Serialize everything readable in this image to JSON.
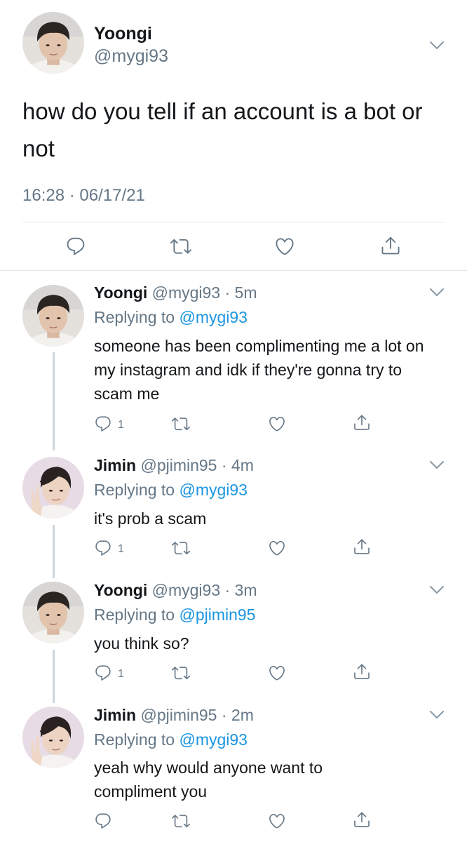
{
  "main_tweet": {
    "name": "Yoongi",
    "handle": "@mygi93",
    "text": "how do you tell if an account is a bot or not",
    "timestamp": "16:28 · 06/17/21"
  },
  "replies": [
    {
      "name": "Yoongi",
      "handle_time": "@mygi93 · 5m",
      "replying_prefix": "Replying to",
      "replying_to": "@mygi93",
      "text": "someone has been complimenting me a lot on my instagram and idk if they're gonna try to scam me",
      "reply_count": "1"
    },
    {
      "name": "Jimin",
      "handle_time": "@pjimin95 · 4m",
      "replying_prefix": "Replying to",
      "replying_to": "@mygi93",
      "text": "it's prob a scam",
      "reply_count": "1"
    },
    {
      "name": "Yoongi",
      "handle_time": "@mygi93 · 3m",
      "replying_prefix": "Replying to",
      "replying_to": "@pjimin95",
      "text": "you think so?",
      "reply_count": "1"
    },
    {
      "name": "Jimin",
      "handle_time": "@pjimin95 · 2m",
      "replying_prefix": "Replying to",
      "replying_to": "@mygi93",
      "text": "yeah why would anyone want to compliment you",
      "reply_count": ""
    }
  ],
  "colors": {
    "text": "#14171a",
    "secondary": "#657786",
    "accent": "#1b95e0",
    "divider": "#e1e8ed"
  },
  "icons": [
    "reply-icon",
    "retweet-icon",
    "like-icon",
    "share-icon",
    "chevron-down-icon"
  ]
}
